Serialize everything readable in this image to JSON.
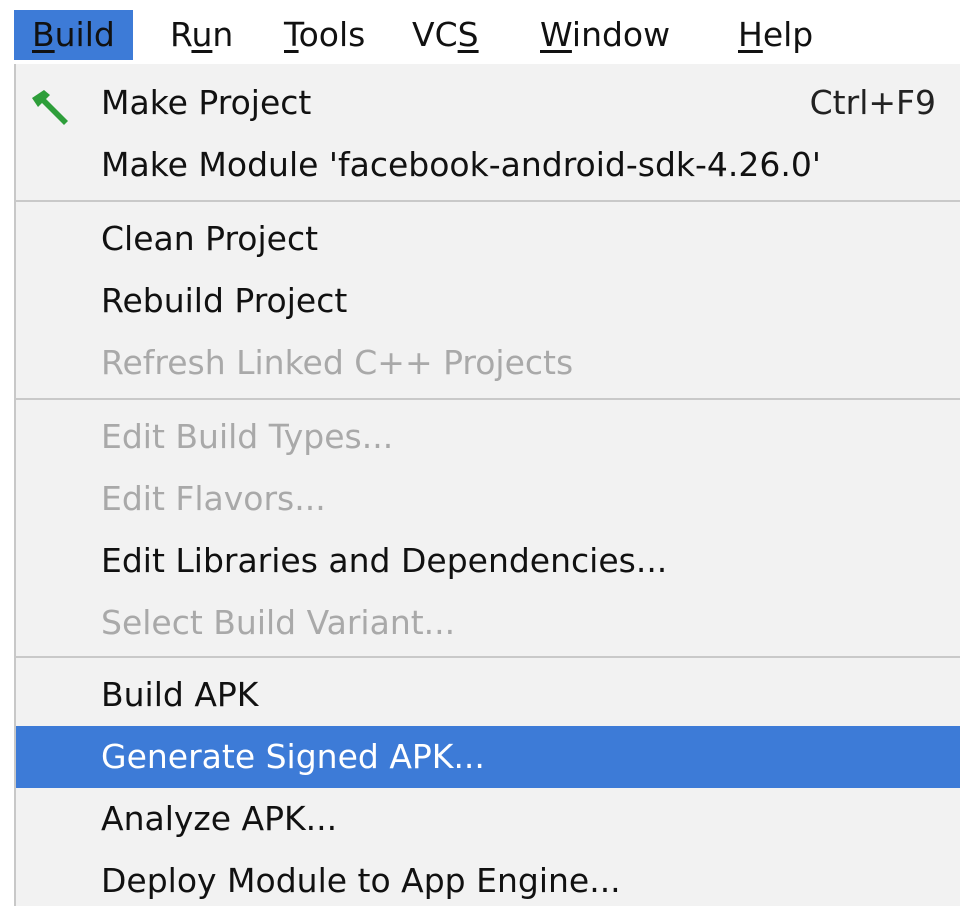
{
  "menubar": {
    "items": [
      {
        "label": "Build",
        "mnemonic": "B",
        "rest": "uild"
      },
      {
        "label": "Run",
        "mnemonic": "u",
        "prefix": "R",
        "rest": "n"
      },
      {
        "label": "Tools",
        "mnemonic": "T",
        "rest": "ools"
      },
      {
        "label": "VCS",
        "prefix": "VC",
        "mnemonic": "S",
        "rest": ""
      },
      {
        "label": "Window",
        "mnemonic": "W",
        "rest": "indow"
      },
      {
        "label": "Help",
        "mnemonic": "H",
        "rest": "elp"
      }
    ]
  },
  "build_menu": {
    "items": [
      {
        "label": "Make Project",
        "shortcut": "Ctrl+F9",
        "icon": "hammer-icon",
        "enabled": true
      },
      {
        "label": "Make Module 'facebook-android-sdk-4.26.0'",
        "enabled": true
      },
      {
        "label": "Clean Project",
        "enabled": true
      },
      {
        "label": "Rebuild Project",
        "enabled": true
      },
      {
        "label": "Refresh Linked C++ Projects",
        "enabled": false
      },
      {
        "label": "Edit Build Types...",
        "enabled": false
      },
      {
        "label": "Edit Flavors...",
        "enabled": false
      },
      {
        "label": "Edit Libraries and Dependencies...",
        "enabled": true
      },
      {
        "label": "Select Build Variant...",
        "enabled": false
      },
      {
        "label": "Build APK",
        "enabled": true
      },
      {
        "label": "Generate Signed APK...",
        "enabled": true,
        "selected": true
      },
      {
        "label": "Analyze APK...",
        "enabled": true
      },
      {
        "label": "Deploy Module to App Engine...",
        "enabled": true
      }
    ]
  },
  "colors": {
    "accent": "#3d7bd7",
    "menu_bg": "#f2f2f2",
    "disabled_text": "#a9a9a9",
    "hammer": "#2e9e3a"
  }
}
